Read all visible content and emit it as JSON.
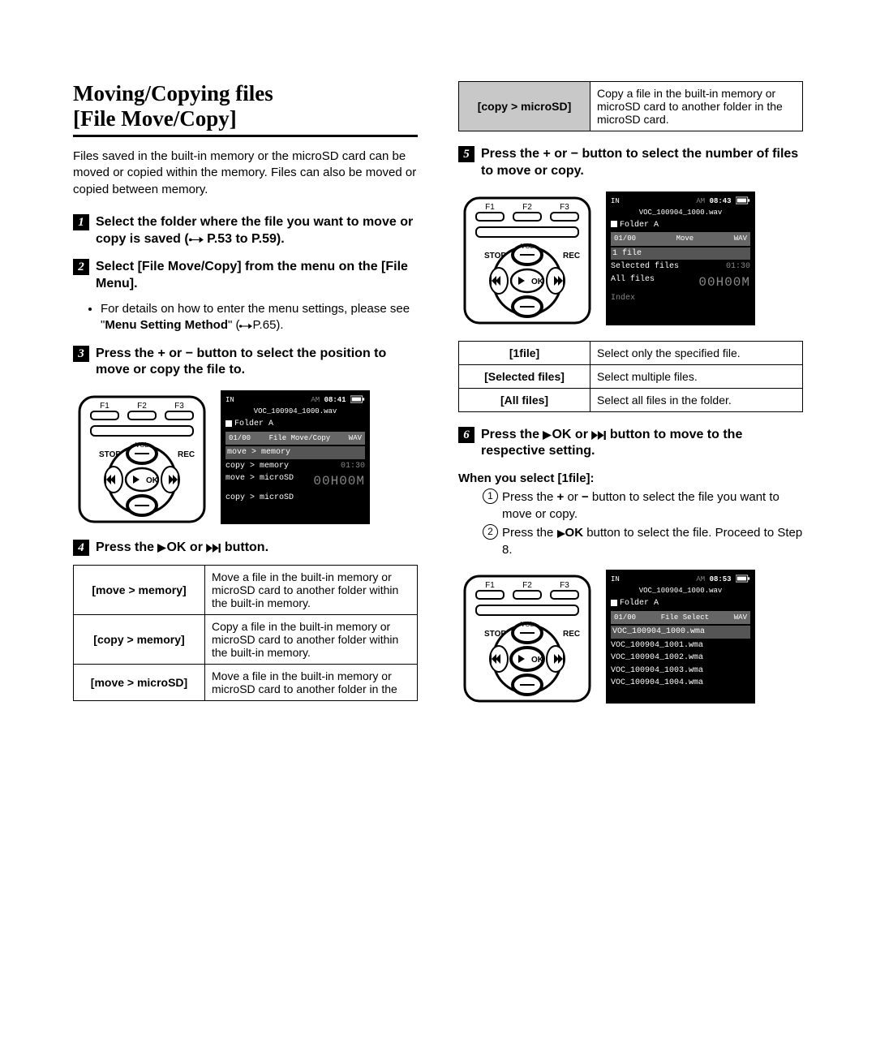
{
  "title_line1": "Moving/Copying files",
  "title_line2": "[File Move/Copy]",
  "intro": "Files saved in the built-in memory or the microSD card can be moved or copied within the memory. Files can also be moved or copied between memory.",
  "steps": {
    "s1": {
      "num": "1",
      "text_a": "Select the folder where the file you want to move or copy is saved (",
      "text_b": " P.53 to P.59)."
    },
    "s2": {
      "num": "2",
      "text": "Select [File Move/Copy] from the menu on the [File Menu].",
      "bullet_a": "For details on how to enter the menu settings, please see \"",
      "bullet_bold": "Menu Setting Method",
      "bullet_b": "\" (",
      "bullet_c": "P.65)."
    },
    "s3": {
      "num": "3",
      "text": "Press the + or − button to select the position to move or copy the file to."
    },
    "s4": {
      "num": "4",
      "text_a": "Press the ",
      "text_b": "OK or ",
      "text_c": " button."
    },
    "s5": {
      "num": "5",
      "text": "Press the + or − button to select the number of files to move or copy."
    },
    "s6": {
      "num": "6",
      "text_a": "Press the ",
      "text_b": "OK or ",
      "text_c": " button to move to the respective setting."
    }
  },
  "device_labels": {
    "f1": "F1",
    "f2": "F2",
    "f3": "F3",
    "stop": "STOP",
    "vol": "VOL",
    "rec": "REC",
    "ok": "OK"
  },
  "lcd1": {
    "in": "IN",
    "time": "08:41",
    "am": "AM",
    "fname": "VOC_100904_1000.wav",
    "folder": "Folder A",
    "idx": "01/00",
    "menu": "File Move/Copy",
    "wav": "WAV",
    "opt1": "move > memory",
    "opt2": "copy > memory",
    "opt2r": "01:30",
    "opt3": "move > microSD",
    "opt3r": "00H00M",
    "opt4": "copy > microSD"
  },
  "lcd2": {
    "in": "IN",
    "time": "08:43",
    "am": "AM",
    "fname": "VOC_100904_1000.wav",
    "folder": "Folder A",
    "idx": "01/00",
    "menu": "Move",
    "wav": "WAV",
    "l1": "1 file",
    "l2a": "Selected files",
    "l2b": "01:30",
    "l3a": "All files",
    "l3b": "00H00M",
    "l4": "Index"
  },
  "lcd3": {
    "in": "IN",
    "time": "08:53",
    "am": "AM",
    "fname": "VOC_100904_1000.wav",
    "folder": "Folder A",
    "idx": "01/00",
    "menu": "File Select",
    "wav": "WAV",
    "f0": "VOC_100904_1000.wma",
    "f1": "VOC_100904_1001.wma",
    "f2": "VOC_100904_1002.wma",
    "f3": "VOC_100904_1003.wma",
    "f4": "VOC_100904_1004.wma"
  },
  "table1": {
    "r1h": "[move > memory]",
    "r1d": "Move a file in the built-in memory or microSD card to another folder within the built-in memory.",
    "r2h": "[copy > memory]",
    "r2d": "Copy a file in the built-in memory or microSD card to another folder within the built-in memory.",
    "r3h": "[move > microSD]",
    "r3d": "Move a file in the built-in memory or microSD card to another folder in the",
    "r4h": "[copy > microSD]",
    "r4d": "Copy a file in the built-in memory or microSD card to another folder in the microSD card."
  },
  "table2": {
    "r1h": "[1file]",
    "r1d": "Select only the specified file.",
    "r2h": "[Selected files]",
    "r2d": "Select multiple files.",
    "r3h": "[All files]",
    "r3d": "Select all files in the folder."
  },
  "when1": {
    "head": "When you select [1file]:",
    "i1a": "Press the ",
    "i1b": "+",
    "i1c": " or ",
    "i1d": "−",
    "i1e": " button to select the file you want to move or copy.",
    "i2a": "Press the ",
    "i2b": "OK",
    "i2c": " button to select the file. Proceed to Step 8."
  }
}
